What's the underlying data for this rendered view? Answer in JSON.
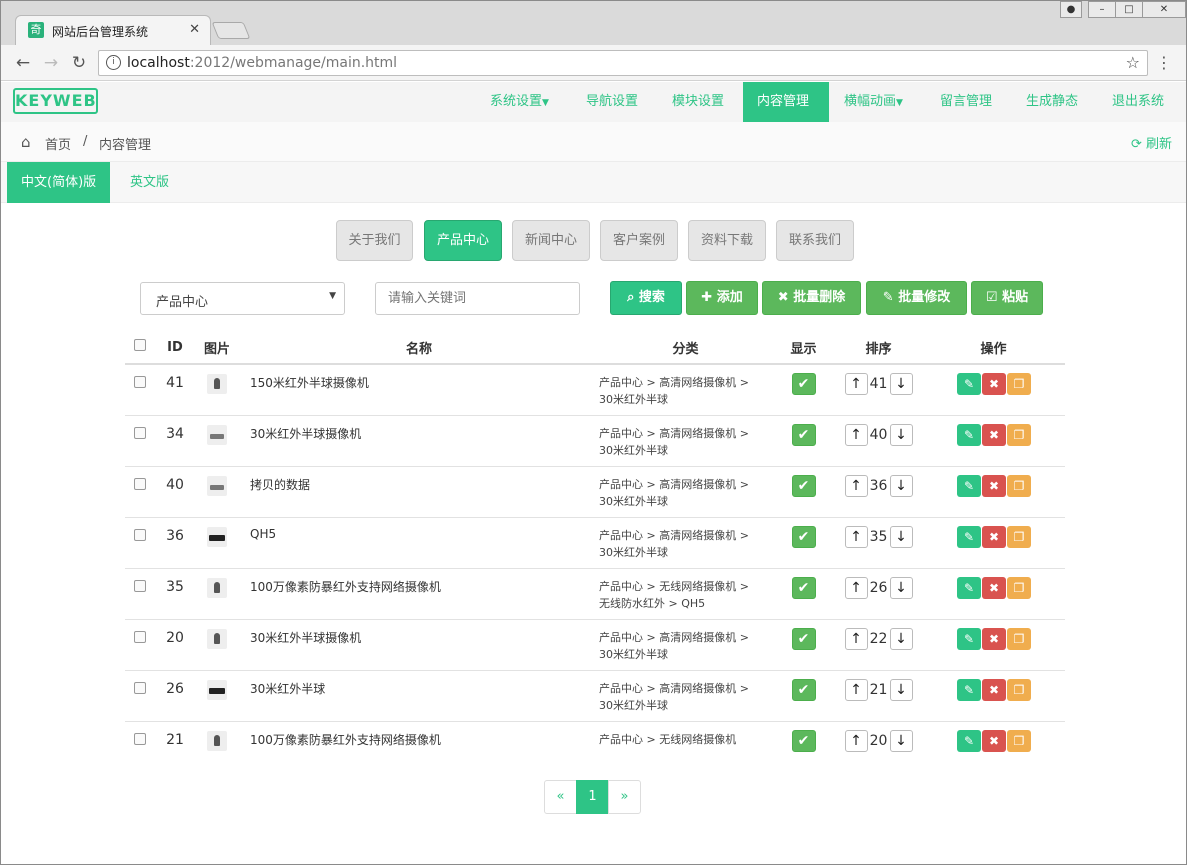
{
  "browser": {
    "tab_title": "网站后台管理系统",
    "url_host": "localhost",
    "url_rest": ":2012/webmanage/main.html"
  },
  "nav": {
    "logo": "KEYWEB",
    "items": [
      "系统设置",
      "导航设置",
      "模块设置",
      "内容管理",
      "横幅动画",
      "留言管理",
      "生成静态",
      "退出系统"
    ],
    "active": "内容管理"
  },
  "breadcrumb": {
    "home": "首页",
    "sep": "/",
    "current": "内容管理",
    "refresh": "刷新"
  },
  "lang_tabs": [
    "中文(简体)版",
    "英文版"
  ],
  "categories": [
    "关于我们",
    "产品中心",
    "新闻中心",
    "客户案例",
    "资料下载",
    "联系我们"
  ],
  "filter": {
    "select_value": "产品中心",
    "search_placeholder": "请输入关键词"
  },
  "actions": [
    "搜索",
    "添加",
    "批量删除",
    "批量修改",
    "粘贴"
  ],
  "table": {
    "headers": [
      "ID",
      "图片",
      "名称",
      "分类",
      "显示",
      "排序",
      "操作"
    ],
    "rows": [
      {
        "id": "41",
        "name": "150米红外半球摄像机",
        "cat1": "产品中心 > 高清网络摄像机 >",
        "cat2": "30米红外半球",
        "sort": "41",
        "icon": "dome-camera"
      },
      {
        "id": "34",
        "name": "30米红外半球摄像机",
        "cat1": "产品中心 > 高清网络摄像机 >",
        "cat2": "30米红外半球",
        "sort": "40",
        "icon": "bullet-camera"
      },
      {
        "id": "40",
        "name": "拷贝的数据",
        "cat1": "产品中心 > 高清网络摄像机 >",
        "cat2": "30米红外半球",
        "sort": "36",
        "icon": "bullet-camera"
      },
      {
        "id": "36",
        "name": "QH5",
        "cat1": "产品中心 > 高清网络摄像机 >",
        "cat2": "30米红外半球",
        "sort": "35",
        "icon": "box-camera"
      },
      {
        "id": "35",
        "name": "100万像素防暴红外支持网络摄像机",
        "cat1": "产品中心 > 无线网络摄像机 >",
        "cat2": "无线防水红外 > QH5",
        "sort": "26",
        "icon": "dome-camera"
      },
      {
        "id": "20",
        "name": "30米红外半球摄像机",
        "cat1": "产品中心 > 高清网络摄像机 >",
        "cat2": "30米红外半球",
        "sort": "22",
        "icon": "dome-camera"
      },
      {
        "id": "26",
        "name": "30米红外半球",
        "cat1": "产品中心 > 高清网络摄像机 >",
        "cat2": "30米红外半球",
        "sort": "21",
        "icon": "box-camera"
      },
      {
        "id": "21",
        "name": "100万像素防暴红外支持网络摄像机",
        "cat1": "产品中心 > 无线网络摄像机",
        "cat2": "",
        "sort": "20",
        "icon": "dome-camera"
      }
    ]
  },
  "pager": {
    "prev": "«",
    "page": "1",
    "next": "»"
  }
}
